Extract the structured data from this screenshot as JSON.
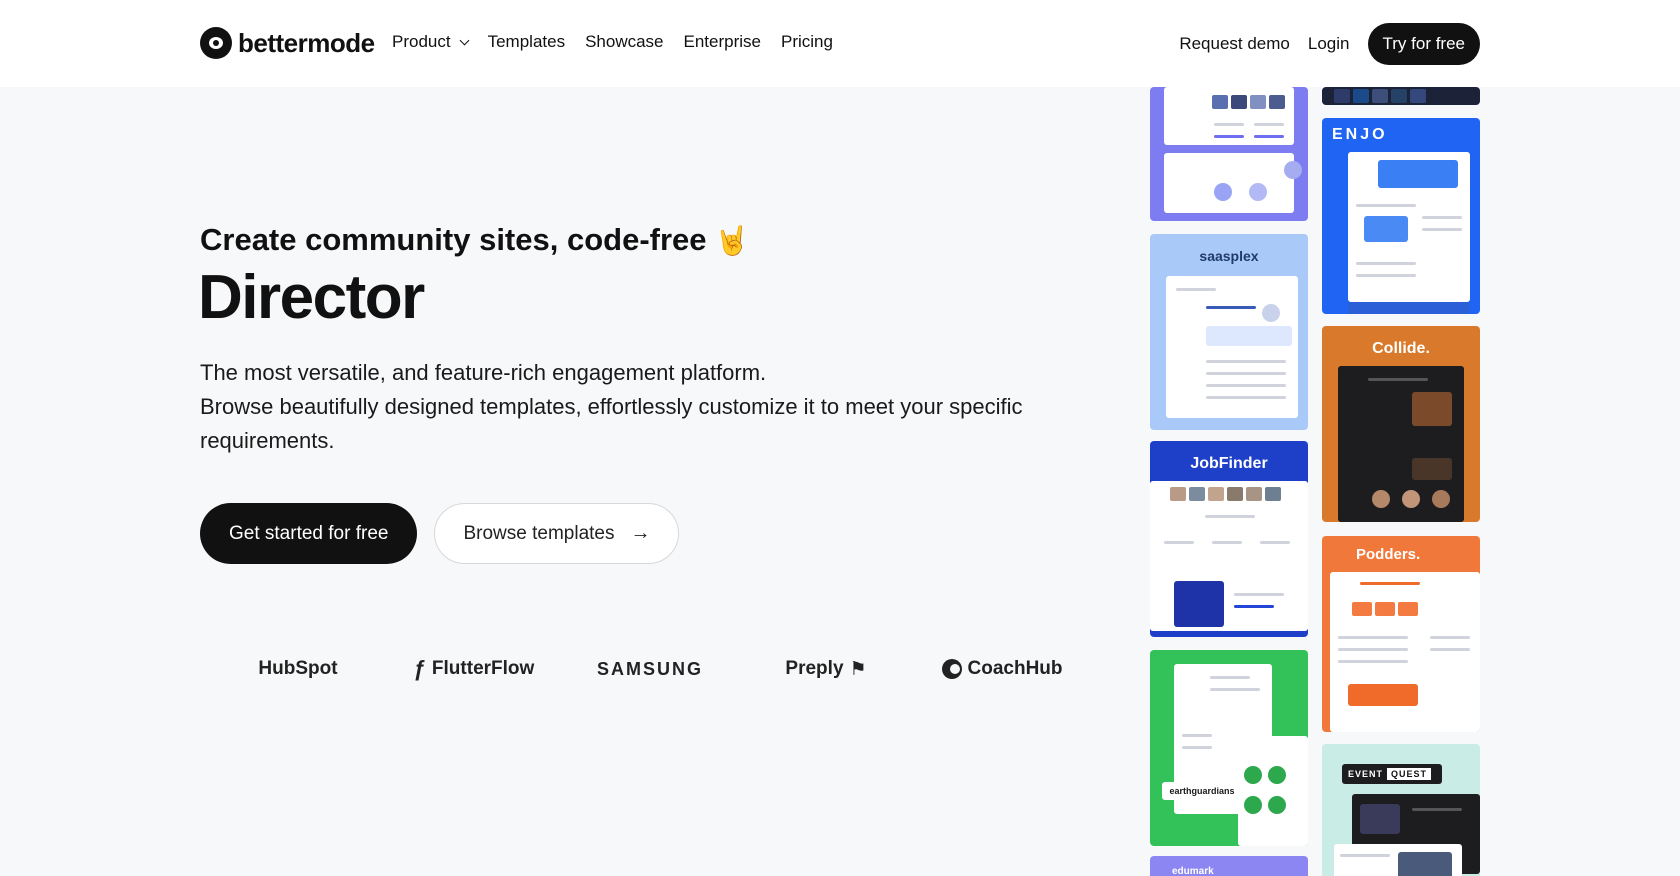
{
  "nav": {
    "brand": "bettermode",
    "menu": [
      "Product",
      "Templates",
      "Showcase",
      "Enterprise",
      "Pricing"
    ],
    "request_demo": "Request demo",
    "login": "Login",
    "try_free": "Try for free"
  },
  "hero": {
    "tagline": "Create community sites, code-free",
    "emoji": "🤘",
    "headline": "Director",
    "description_line1": "The most versatile, and feature-rich engagement platform.",
    "description_line2": "Browse beautifully designed templates, effortlessly customize it to meet your specific requirements.",
    "primary_cta": "Get started for free",
    "secondary_cta": "Browse templates",
    "arrow": "→"
  },
  "logos": [
    "HubSpot",
    "FlutterFlow",
    "SAMSUNG",
    "Preply",
    "CoachHub"
  ],
  "showcase": {
    "saasplex": "saasplex",
    "jobfinder": "JobFinder",
    "earthguardians": "earthguardians",
    "edumark": "edumark",
    "enjo": "ENJO",
    "collide": "Collide.",
    "podders": "Podders.",
    "event": "EVENT",
    "quest": "QUEST"
  },
  "colors": {
    "accent": "#111111",
    "background": "#f7f8fa",
    "saasplex": "#8fb6f5",
    "jobfinder": "#1e3fc8",
    "earthguardians": "#33c25a",
    "enjo": "#1f64f2",
    "collide": "#d9792b",
    "podders": "#f0783a",
    "eventquest": "#c9ece6"
  }
}
